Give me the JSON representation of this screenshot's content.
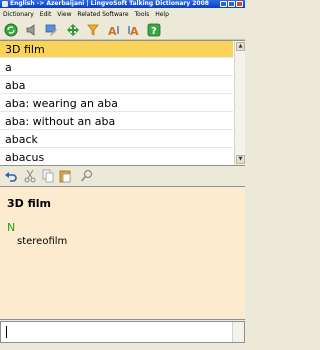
{
  "window": {
    "title": "English -> Azerbaijani | LingvoSoft Talking Dictionary 2008"
  },
  "menu": [
    "Dictionary",
    "Edit",
    "View",
    "Related Software",
    "Tools",
    "Help"
  ],
  "toolbar": {
    "icons": [
      "refresh-icon",
      "speaker-icon",
      "flag-edit-icon",
      "navigate-icon",
      "filter-icon",
      "font-smaller-icon",
      "font-larger-icon",
      "help-icon"
    ]
  },
  "word_list": {
    "selected_index": 0,
    "items": [
      "3D film",
      "a",
      "aba",
      "aba: wearing an aba",
      "aba: without an aba",
      "aback",
      "abacus"
    ]
  },
  "edit_toolbar": {
    "icons": [
      "undo-icon",
      "cut-icon",
      "copy-icon",
      "paste-icon",
      "find-icon"
    ]
  },
  "article": {
    "headword": "3D film",
    "part_of_speech": "N",
    "translation": "stereofilm"
  },
  "search": {
    "value": ""
  },
  "colors": {
    "selection": "#fad45a",
    "article_bg": "#fdebcf",
    "part_of_speech": "#1aa80f"
  }
}
